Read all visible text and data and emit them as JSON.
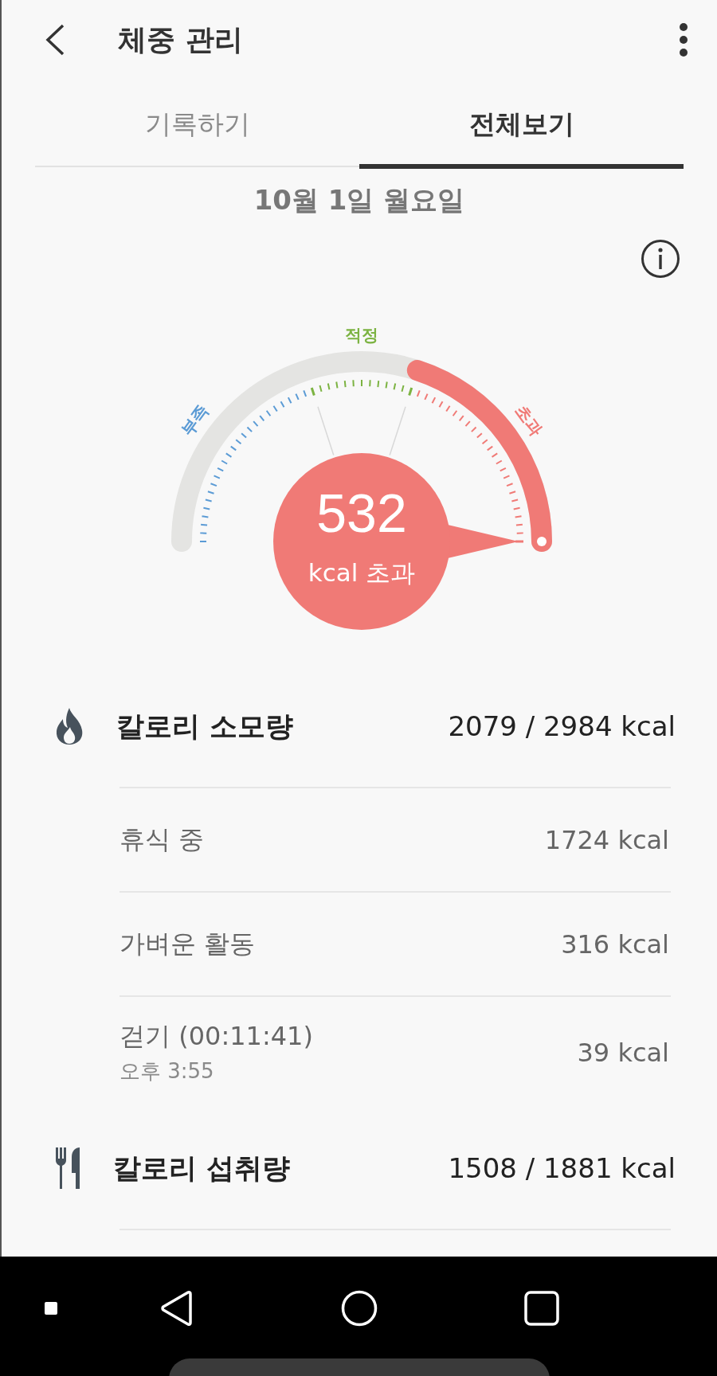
{
  "header": {
    "title": "체중 관리"
  },
  "tabs": [
    {
      "label": "기록하기",
      "selected": false
    },
    {
      "label": "전체보기",
      "selected": true
    }
  ],
  "date": "10월 1일 월요일",
  "gauge": {
    "zones": [
      {
        "label": "부족",
        "color": "#5b9bd5"
      },
      {
        "label": "적정",
        "color": "#7cb342"
      },
      {
        "label": "초과",
        "color": "#f07a76"
      }
    ],
    "value": "532",
    "unit": "kcal 초과"
  },
  "sections": [
    {
      "kind": "burned",
      "title": "칼로리 소모량",
      "total": "2079 / 2984 kcal",
      "items": [
        {
          "label": "휴식 중",
          "value": "1724 kcal"
        },
        {
          "label": "가벼운 활동",
          "value": "316 kcal"
        },
        {
          "label": "걷기 (00:11:41)",
          "time": "오후 3:55",
          "value": "39 kcal"
        }
      ]
    },
    {
      "kind": "intake",
      "title": "칼로리 섭취량",
      "total": "1508 / 1881 kcal"
    }
  ]
}
